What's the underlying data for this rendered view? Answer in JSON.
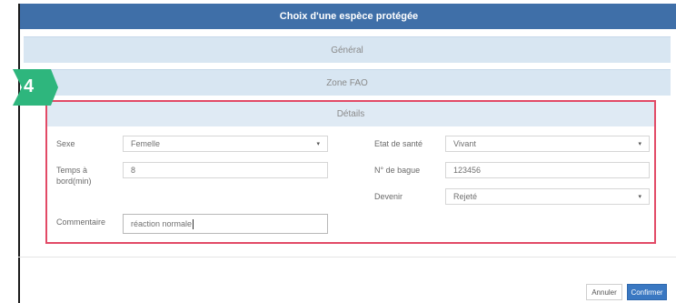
{
  "dialog": {
    "title": "Choix d'une espèce protégée",
    "sections": [
      {
        "label": "Général"
      },
      {
        "label": "Zone FAO"
      },
      {
        "label": "Détails"
      }
    ]
  },
  "form": {
    "sexe": {
      "label": "Sexe",
      "value": "Femelle"
    },
    "temps": {
      "label_line1": "Temps à",
      "label_line2": "bord(min)",
      "value": "8"
    },
    "etat": {
      "label": "Etat de santé",
      "value": "Vivant"
    },
    "bague": {
      "label": "N° de bague",
      "value": "123456"
    },
    "devenir": {
      "label": "Devenir",
      "value": "Rejeté"
    },
    "commentaire": {
      "label": "Commentaire",
      "value": "réaction normale"
    }
  },
  "footer": {
    "cancel_label": "Annuler",
    "confirm_label": "Confirmer"
  },
  "annotation": {
    "number": "4",
    "color": "#2eb67d",
    "highlight_color": "#e24a66"
  }
}
